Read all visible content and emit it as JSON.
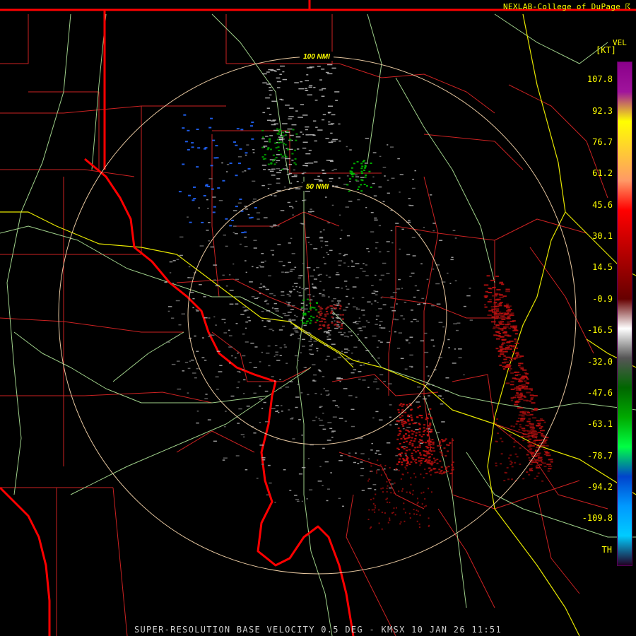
{
  "header": {
    "credit": "NEXLAB-College of DuPage ☈"
  },
  "footer": {
    "product": "SUPER-RESOLUTION BASE VELOCITY",
    "elevation": "0.5 DEG",
    "site": "KMSX",
    "datetime": "10 JAN 26 11:51",
    "full_text": "SUPER-RESOLUTION BASE VELOCITY 0.5 DEG - KMSX 10 JAN 26 11:51"
  },
  "range_rings": [
    {
      "label": "100 NMI",
      "range_nmi": 100
    },
    {
      "label": "50 NMI",
      "range_nmi": 50
    }
  ],
  "legend": {
    "title": "VEL",
    "unit": "[KT]",
    "ticks": [
      "107.8",
      "92.3",
      "76.7",
      "61.2",
      "45.6",
      "30.1",
      "14.5",
      "-0.9",
      "-16.5",
      "-32.0",
      "-47.6",
      "-63.1",
      "-78.7",
      "-94.2",
      "-109.8"
    ],
    "bottom_label": "TH",
    "color_stops": [
      {
        "color": "#8a008a"
      },
      {
        "color": "#a0149c"
      },
      {
        "color": "#ffff00"
      },
      {
        "color": "#ffcc33"
      },
      {
        "color": "#ff9966"
      },
      {
        "color": "#ff0000"
      },
      {
        "color": "#cc0000"
      },
      {
        "color": "#990000"
      },
      {
        "color": "#660000"
      },
      {
        "color": "#ffffff"
      },
      {
        "color": "#555555"
      },
      {
        "color": "#006600"
      },
      {
        "color": "#00aa00"
      },
      {
        "color": "#00ff44"
      },
      {
        "color": "#0044cc"
      },
      {
        "color": "#0099ff"
      },
      {
        "color": "#00ccff"
      },
      {
        "color": "#220022"
      }
    ]
  },
  "colors": {
    "state_border": "#ff0000",
    "county_border": "#cc2222",
    "highway_primary": "#e6e600",
    "highway_secondary": "#9fd08a",
    "range_ring": "#e8c8a0",
    "inbound": "#00c000",
    "outbound": "#d01010"
  }
}
